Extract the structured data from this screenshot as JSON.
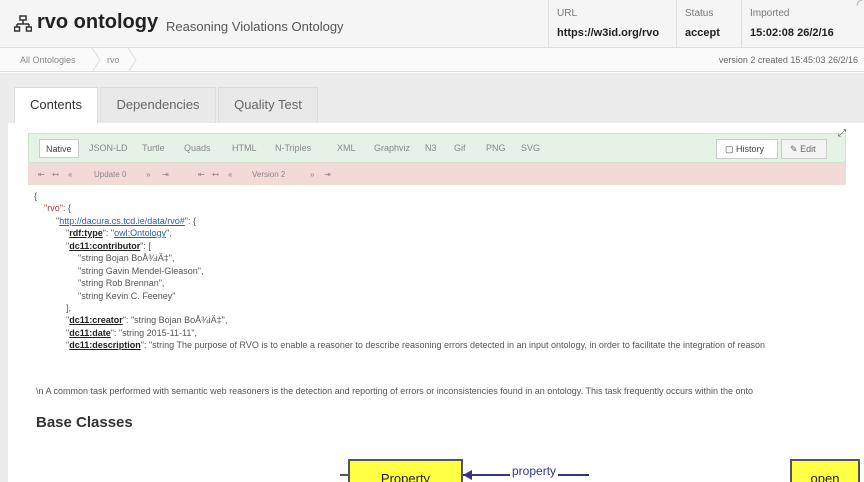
{
  "header": {
    "icon": "hierarchy-icon",
    "app_name": "rvo ontology",
    "subtitle": "Reasoning Violations Ontology",
    "url_label": "URL",
    "url_value": "https://w3id.org/rvo",
    "status_label": "Status",
    "status_value": "accept",
    "imported_label": "Imported",
    "imported_value": "15:02:08 26/2/16"
  },
  "breadcrumb": {
    "items": [
      "All Ontologies",
      "rvo"
    ],
    "version_note": "version 2 created 15:45:03 26/2/16"
  },
  "tabs": [
    {
      "label": "Contents",
      "active": true
    },
    {
      "label": "Dependencies",
      "active": false
    },
    {
      "label": "Quality Test",
      "active": false
    }
  ],
  "formats": [
    "Native",
    "JSON-LD",
    "Turtle",
    "Quads",
    "HTML",
    "N-Triples",
    "XML",
    "Graphviz",
    "N3",
    "Gif",
    "PNG",
    "SVG"
  ],
  "active_format": "Native",
  "buttons": {
    "history": "History",
    "edit": "Edit"
  },
  "version_bar": {
    "update": "Update 0",
    "version": "Version 2"
  },
  "json": {
    "open_brace": "{",
    "rvo_key": "\"rvo\"",
    "rvo_open": ": {",
    "ns_url": "http://dacura.cs.tcd.ie/data/rvo#",
    "ns_open": "\": {",
    "rdf_type_key": "rdf:type",
    "rdf_type_val": "owl:Ontology",
    "contributor_key": "dc11:contributor",
    "contributors": [
      "\"string Bojan BoÅ¾iÄ‡\",",
      "\"string Gavin Mendel-Gleason\",",
      "\"string Rob Brennan\",",
      "\"string Kevin C. Feeney\""
    ],
    "close_bracket": "],",
    "creator_key": "dc11:creator",
    "creator_val": ": \"string Bojan BoÅ¾iÄ‡\",",
    "date_key": "dc11:date",
    "date_val": ": \"string 2015-11-11\",",
    "description_key": "dc11:description",
    "description_val": ": \"string The purpose of RVO is to enable a reasoner to describe reasoning errors detected in an input ontology, in order to facilitate the integration of reason"
  },
  "description_text": "\\n   A common task performed with semantic web reasoners is the detection and reporting of errors or inconsistencies found in an ontology. This task frequently occurs within the onto",
  "base_classes_title": "Base Classes",
  "diagram": {
    "nodes": [
      "Property",
      "open"
    ],
    "edge_label": "property"
  }
}
